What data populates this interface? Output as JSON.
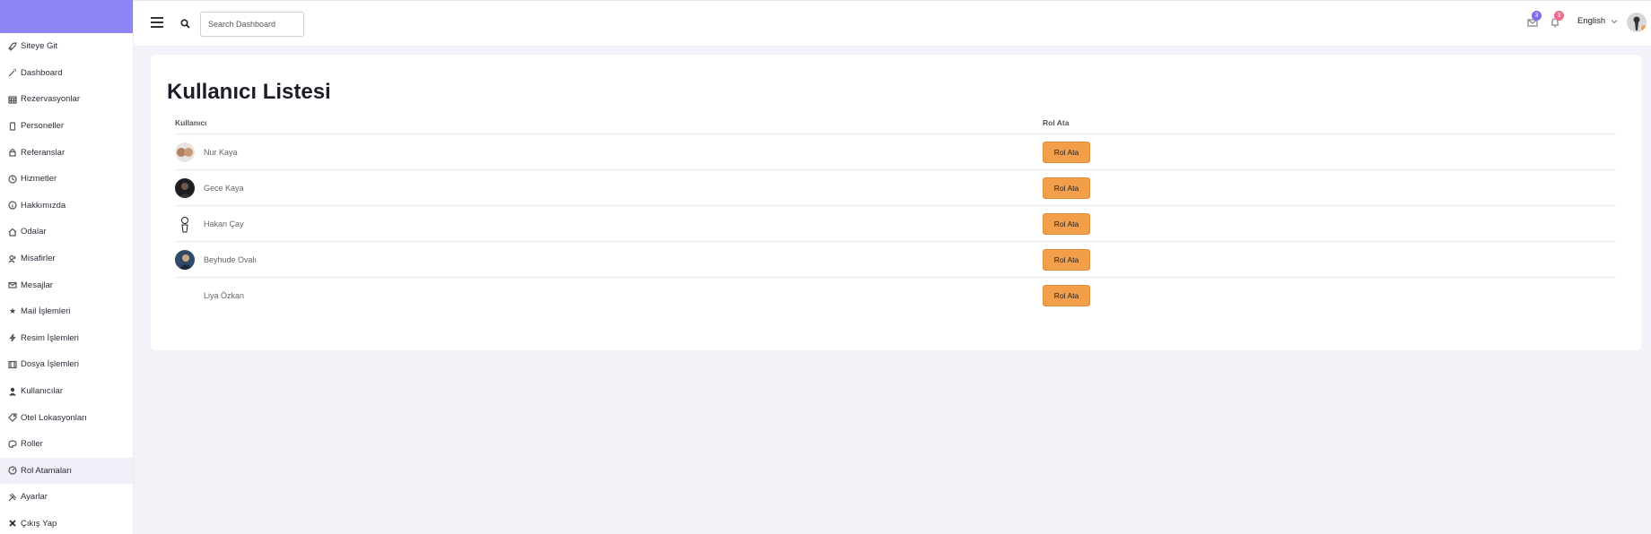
{
  "sidebar": {
    "items": [
      {
        "label": "Siteye Git",
        "icon": "rocket-icon"
      },
      {
        "label": "Dashboard",
        "icon": "wand-icon"
      },
      {
        "label": "Rezervasyonlar",
        "icon": "calendar-icon"
      },
      {
        "label": "Personeller",
        "icon": "phone-icon"
      },
      {
        "label": "Referanslar",
        "icon": "lock-icon"
      },
      {
        "label": "Hizmetler",
        "icon": "clock-icon"
      },
      {
        "label": "Hakkımızda",
        "icon": "info-icon"
      },
      {
        "label": "Odalar",
        "icon": "home-icon"
      },
      {
        "label": "Misafirler",
        "icon": "users-icon"
      },
      {
        "label": "Mesajlar",
        "icon": "mail-icon"
      },
      {
        "label": "Mail İşlemleri",
        "icon": "star-icon"
      },
      {
        "label": "Resim İşlemleri",
        "icon": "bolt-icon"
      },
      {
        "label": "Dosya İşlemleri",
        "icon": "film-icon"
      },
      {
        "label": "Kullanıcılar",
        "icon": "user-icon"
      },
      {
        "label": "Otel Lokasyonları",
        "icon": "tag-icon"
      },
      {
        "label": "Roller",
        "icon": "palette-icon"
      },
      {
        "label": "Rol Atamaları",
        "icon": "gauge-icon"
      },
      {
        "label": "Ayarlar",
        "icon": "tools-icon"
      },
      {
        "label": "Çıkış Yap",
        "icon": "x-icon"
      }
    ],
    "active_index": 16
  },
  "topbar": {
    "search_placeholder": "Search Dashboard",
    "mail_count": "3",
    "notif_count": "3",
    "language": "English"
  },
  "page": {
    "title": "Kullanıcı Listesi",
    "columns": {
      "user": "Kullanıcı",
      "role": "Rol Ata"
    },
    "users": [
      {
        "name": "Nur Kaya",
        "button": "Rol Ata"
      },
      {
        "name": "Gece Kaya",
        "button": "Rol Ata"
      },
      {
        "name": "Hakan Çay",
        "button": "Rol Ata"
      },
      {
        "name": "Beyhude Ovalı",
        "button": "Rol Ata"
      },
      {
        "name": "Liya Özkan",
        "button": "Rol Ata"
      }
    ]
  },
  "colors": {
    "brand": "#8c85f3",
    "button": "#f29f4c",
    "mail_badge": "#7b6ff0",
    "notif_badge": "#f06b8a"
  }
}
